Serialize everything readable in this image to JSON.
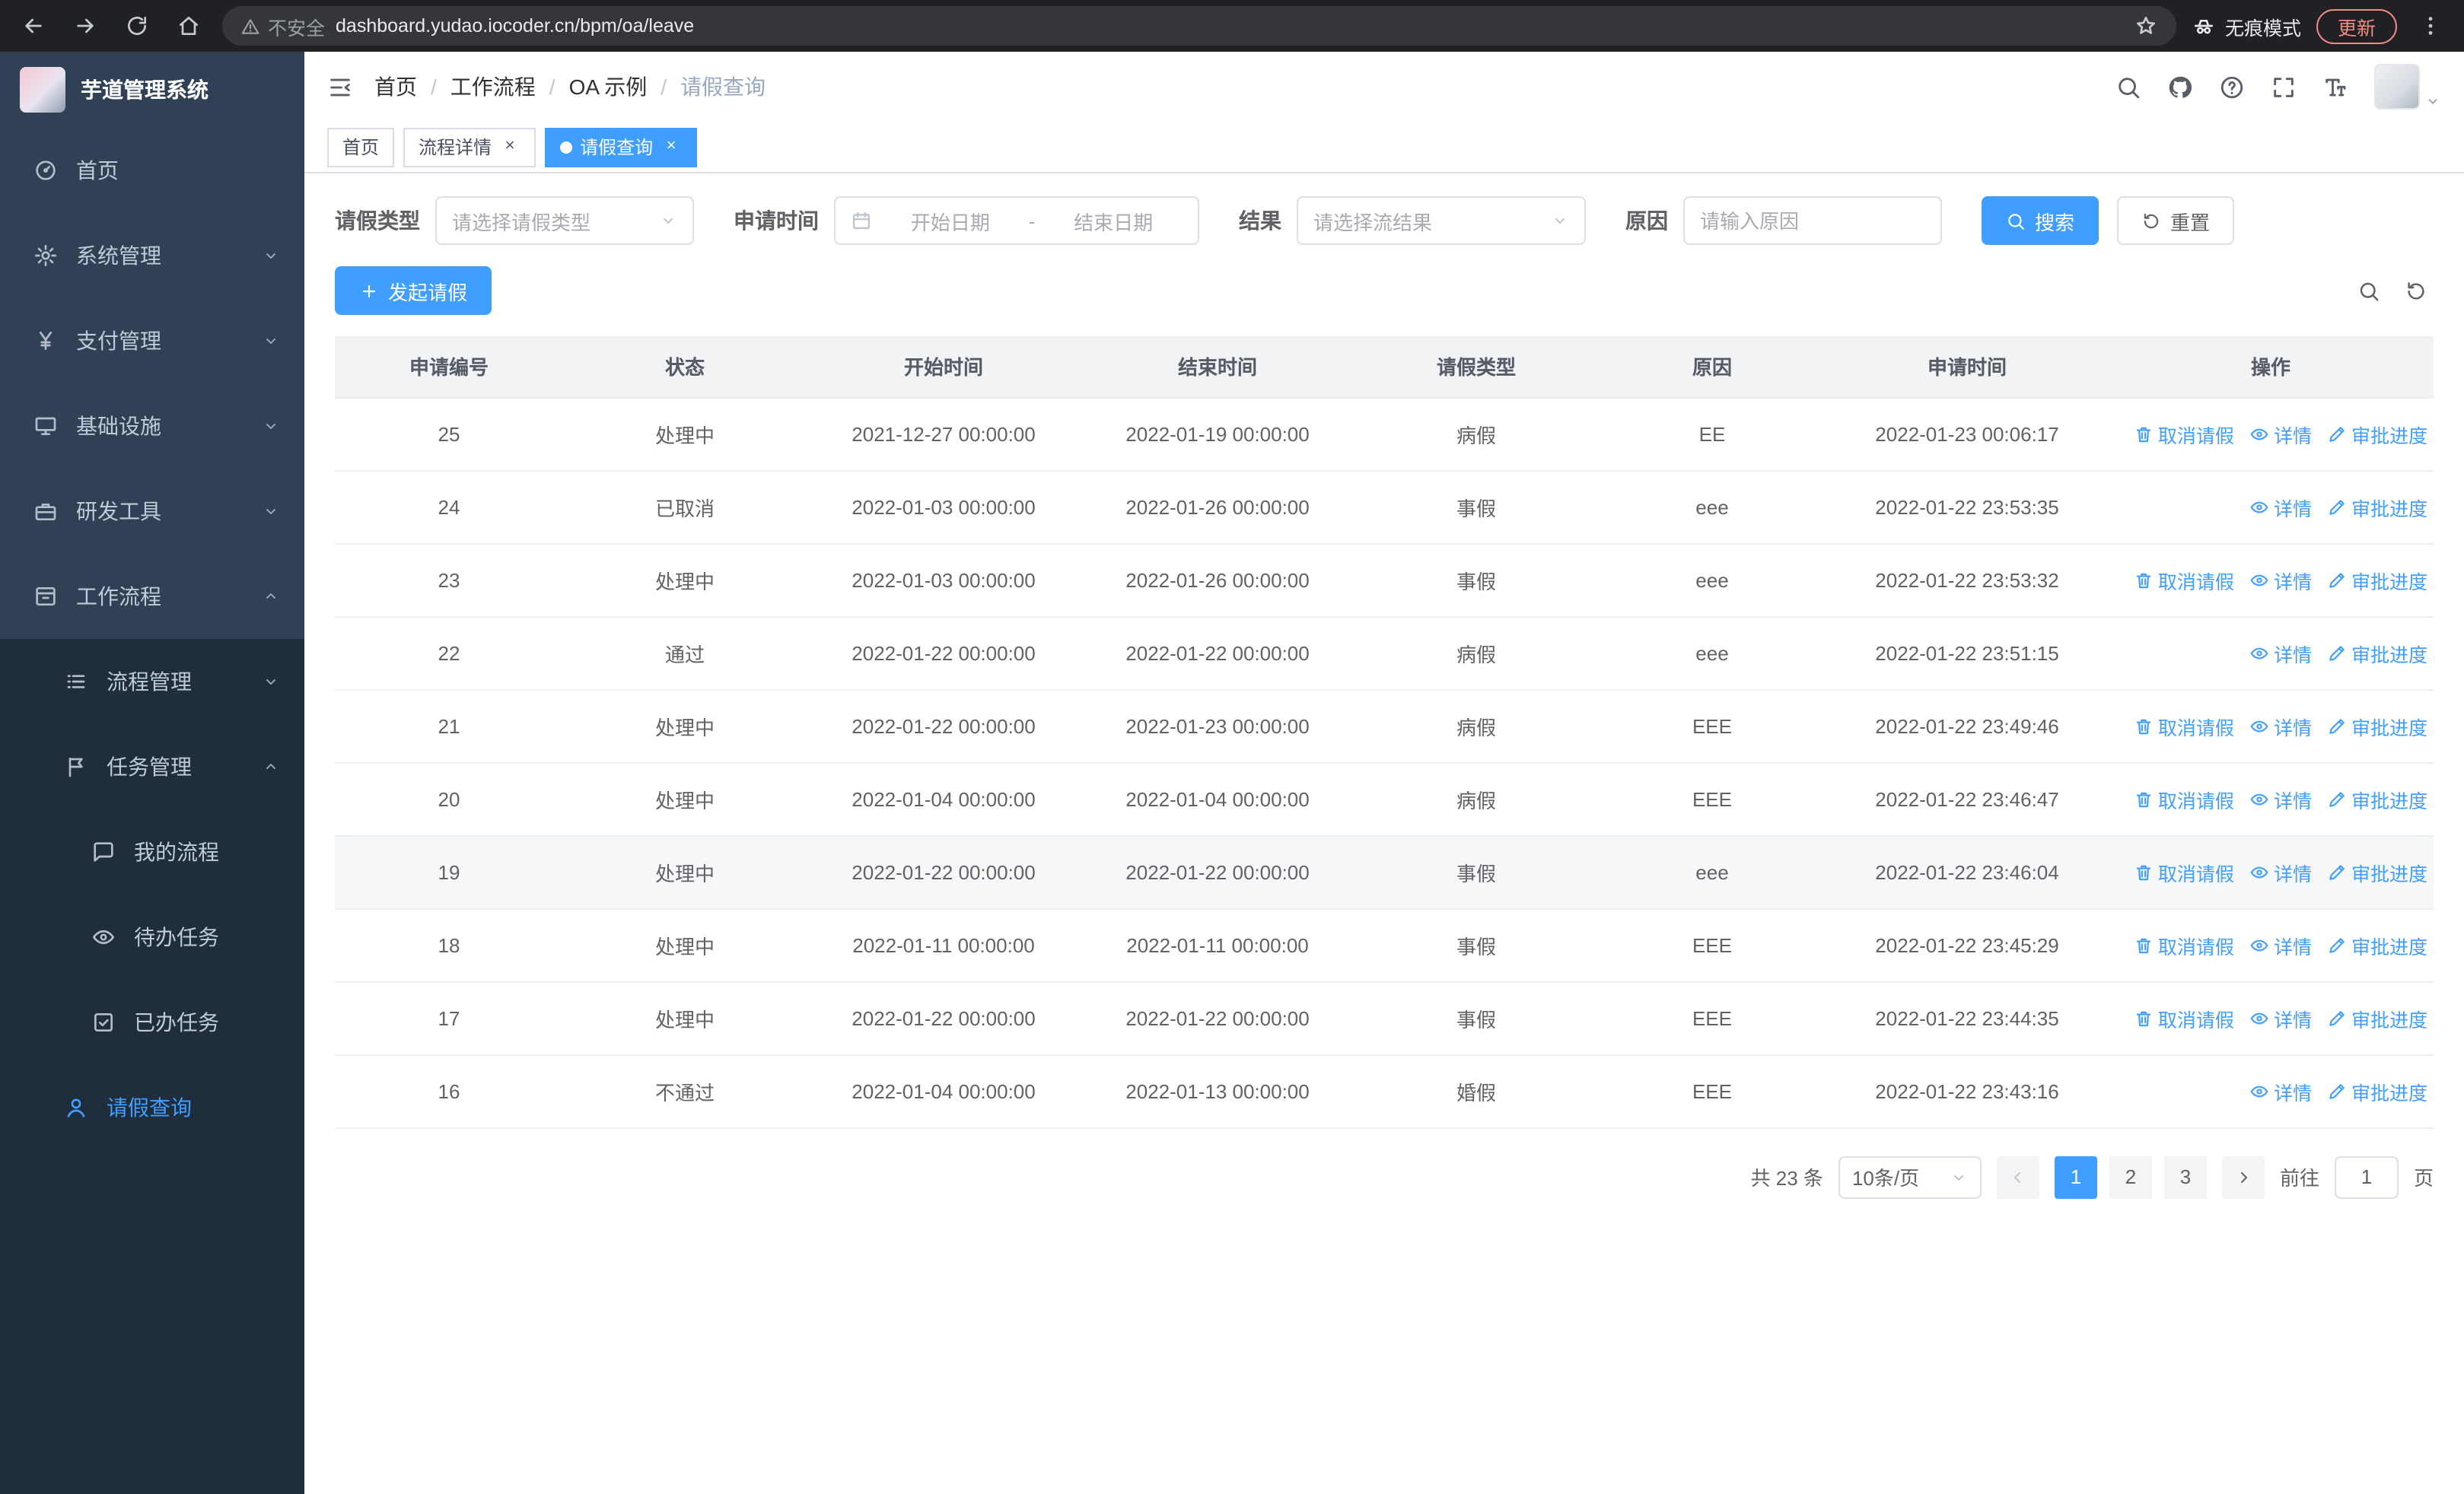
{
  "theme": {
    "primary": "#409eff",
    "sidebar_bg": "#304156",
    "submenu_bg": "#1f2d3d"
  },
  "browser": {
    "security_label": "不安全",
    "url": "dashboard.yudao.iocoder.cn/bpm/oa/leave",
    "incognito_label": "无痕模式",
    "update_label": "更新"
  },
  "sidebar": {
    "logo_title": "芋道管理系统",
    "items": [
      {
        "name": "home",
        "label": "首页",
        "icon": "dashboard",
        "level": 0,
        "chevron": null,
        "active": false
      },
      {
        "name": "system",
        "label": "系统管理",
        "icon": "gear",
        "level": 0,
        "chevron": "down",
        "active": false
      },
      {
        "name": "payment",
        "label": "支付管理",
        "icon": "yen",
        "level": 0,
        "chevron": "down",
        "active": false
      },
      {
        "name": "infrastructure",
        "label": "基础设施",
        "icon": "infra",
        "level": 0,
        "chevron": "down",
        "active": false
      },
      {
        "name": "dev-tools",
        "label": "研发工具",
        "icon": "tool",
        "level": 0,
        "chevron": "down",
        "active": false
      },
      {
        "name": "workflow",
        "label": "工作流程",
        "icon": "workflow",
        "level": 0,
        "chevron": "up",
        "active": false
      },
      {
        "name": "process-mgmt",
        "label": "流程管理",
        "icon": "listicon",
        "level": 1,
        "chevron": "down",
        "active": false
      },
      {
        "name": "task-mgmt",
        "label": "任务管理",
        "icon": "flag",
        "level": 1,
        "chevron": "up",
        "active": false
      },
      {
        "name": "my-process",
        "label": "我的流程",
        "icon": "chat",
        "level": 2,
        "chevron": null,
        "active": false
      },
      {
        "name": "todo-task",
        "label": "待办任务",
        "icon": "eye",
        "level": 2,
        "chevron": null,
        "active": false
      },
      {
        "name": "done-task",
        "label": "已办任务",
        "icon": "done",
        "level": 2,
        "chevron": null,
        "active": false
      },
      {
        "name": "leave-query",
        "label": "请假查询",
        "icon": "user",
        "level": 1,
        "chevron": null,
        "active": true
      }
    ]
  },
  "header": {
    "breadcrumb": [
      "首页",
      "工作流程",
      "OA 示例",
      "请假查询"
    ]
  },
  "tabs": [
    {
      "name": "home",
      "label": "首页",
      "closable": false,
      "active": false
    },
    {
      "name": "process-detail",
      "label": "流程详情",
      "closable": true,
      "active": false
    },
    {
      "name": "leave-query",
      "label": "请假查询",
      "closable": true,
      "active": true
    }
  ],
  "filters": {
    "type_label": "请假类型",
    "type_placeholder": "请选择请假类型",
    "time_label": "申请时间",
    "time_start_placeholder": "开始日期",
    "time_separator": "-",
    "time_end_placeholder": "结束日期",
    "result_label": "结果",
    "result_placeholder": "请选择流结果",
    "reason_label": "原因",
    "reason_placeholder": "请输入原因",
    "search_label": "搜索",
    "reset_label": "重置"
  },
  "toolbar": {
    "create_label": "发起请假"
  },
  "table": {
    "columns": [
      "申请编号",
      "状态",
      "开始时间",
      "结束时间",
      "请假类型",
      "原因",
      "申请时间",
      "操作"
    ],
    "column_keys": [
      "apply-id",
      "status",
      "start-time",
      "end-time",
      "leave-type",
      "reason",
      "apply-time",
      "actions"
    ],
    "action_labels": {
      "cancel": "取消请假",
      "detail": "详情",
      "progress": "审批进度"
    },
    "rows": [
      {
        "id": "25",
        "status": "处理中",
        "start": "2021-12-27 00:00:00",
        "end": "2022-01-19 00:00:00",
        "type": "病假",
        "reason": "EE",
        "applied": "2022-01-23 00:06:17",
        "actions": [
          "cancel",
          "detail",
          "progress"
        ],
        "hover": false
      },
      {
        "id": "24",
        "status": "已取消",
        "start": "2022-01-03 00:00:00",
        "end": "2022-01-26 00:00:00",
        "type": "事假",
        "reason": "eee",
        "applied": "2022-01-22 23:53:35",
        "actions": [
          "detail",
          "progress"
        ],
        "hover": false
      },
      {
        "id": "23",
        "status": "处理中",
        "start": "2022-01-03 00:00:00",
        "end": "2022-01-26 00:00:00",
        "type": "事假",
        "reason": "eee",
        "applied": "2022-01-22 23:53:32",
        "actions": [
          "cancel",
          "detail",
          "progress"
        ],
        "hover": false
      },
      {
        "id": "22",
        "status": "通过",
        "start": "2022-01-22 00:00:00",
        "end": "2022-01-22 00:00:00",
        "type": "病假",
        "reason": "eee",
        "applied": "2022-01-22 23:51:15",
        "actions": [
          "detail",
          "progress"
        ],
        "hover": false
      },
      {
        "id": "21",
        "status": "处理中",
        "start": "2022-01-22 00:00:00",
        "end": "2022-01-23 00:00:00",
        "type": "病假",
        "reason": "EEE",
        "applied": "2022-01-22 23:49:46",
        "actions": [
          "cancel",
          "detail",
          "progress"
        ],
        "hover": false
      },
      {
        "id": "20",
        "status": "处理中",
        "start": "2022-01-04 00:00:00",
        "end": "2022-01-04 00:00:00",
        "type": "病假",
        "reason": "EEE",
        "applied": "2022-01-22 23:46:47",
        "actions": [
          "cancel",
          "detail",
          "progress"
        ],
        "hover": false
      },
      {
        "id": "19",
        "status": "处理中",
        "start": "2022-01-22 00:00:00",
        "end": "2022-01-22 00:00:00",
        "type": "事假",
        "reason": "eee",
        "applied": "2022-01-22 23:46:04",
        "actions": [
          "cancel",
          "detail",
          "progress"
        ],
        "hover": true
      },
      {
        "id": "18",
        "status": "处理中",
        "start": "2022-01-11 00:00:00",
        "end": "2022-01-11 00:00:00",
        "type": "事假",
        "reason": "EEE",
        "applied": "2022-01-22 23:45:29",
        "actions": [
          "cancel",
          "detail",
          "progress"
        ],
        "hover": false
      },
      {
        "id": "17",
        "status": "处理中",
        "start": "2022-01-22 00:00:00",
        "end": "2022-01-22 00:00:00",
        "type": "事假",
        "reason": "EEE",
        "applied": "2022-01-22 23:44:35",
        "actions": [
          "cancel",
          "detail",
          "progress"
        ],
        "hover": false
      },
      {
        "id": "16",
        "status": "不通过",
        "start": "2022-01-04 00:00:00",
        "end": "2022-01-13 00:00:00",
        "type": "婚假",
        "reason": "EEE",
        "applied": "2022-01-22 23:43:16",
        "actions": [
          "detail",
          "progress"
        ],
        "hover": false
      }
    ]
  },
  "pagination": {
    "total_label": "共 23 条",
    "page_size_label": "10条/页",
    "pages": [
      "1",
      "2",
      "3"
    ],
    "active_page": "1",
    "goto_label": "前往",
    "goto_value": "1",
    "goto_suffix": "页"
  }
}
